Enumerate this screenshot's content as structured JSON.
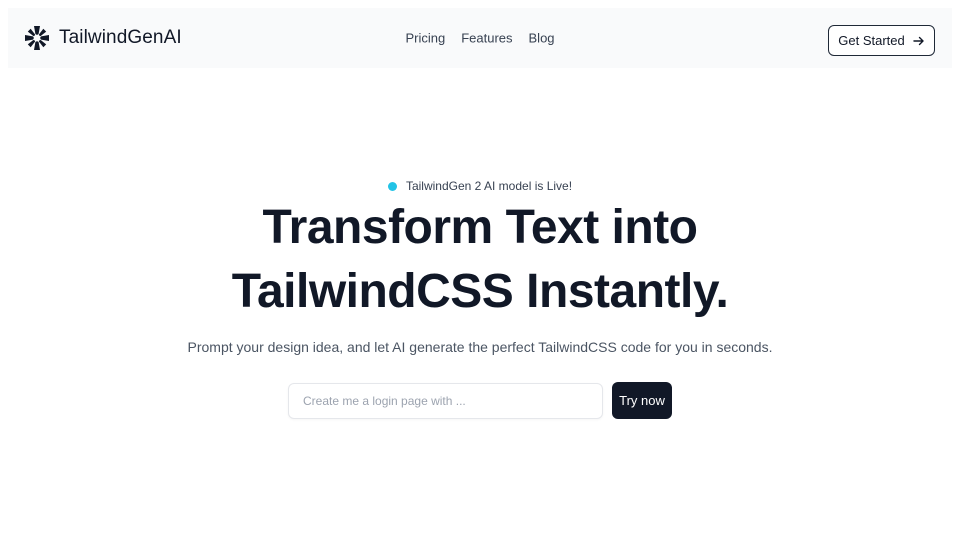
{
  "brand": {
    "name": "TailwindGenAI",
    "logo_icon": "asterisk-logo-icon"
  },
  "nav": {
    "links": [
      {
        "label": "Pricing"
      },
      {
        "label": "Features"
      },
      {
        "label": "Blog"
      }
    ],
    "cta_label": "Get Started",
    "cta_icon": "arrow-right-icon"
  },
  "hero": {
    "badge_text": "TailwindGen 2 AI model is Live!",
    "badge_dot_color": "#22c3e6",
    "headline_line1": "Transform Text into",
    "headline_line2": "TailwindCSS Instantly.",
    "subtitle": "Prompt your design idea, and let AI generate the perfect TailwindCSS code for you in seconds.",
    "input_placeholder": "Create me a login page with ...",
    "input_value": "",
    "submit_label": "Try now"
  },
  "colors": {
    "primary_dark": "#111827",
    "navbar_bg": "#f9fafb"
  }
}
